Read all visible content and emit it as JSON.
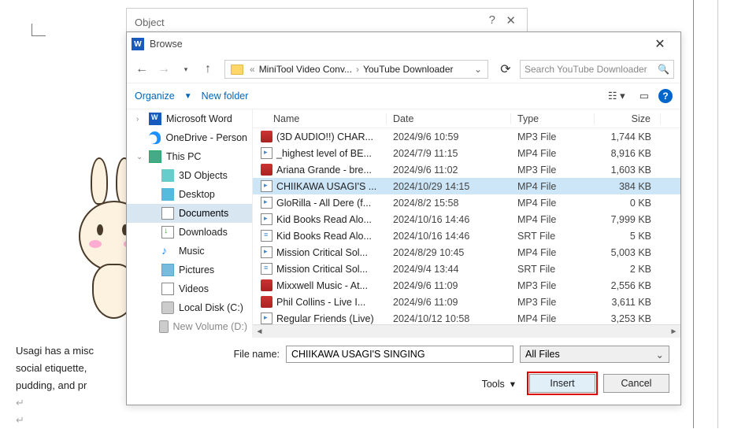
{
  "object_dialog": {
    "title": "Object"
  },
  "browse": {
    "title": "Browse",
    "breadcrumb": {
      "seg1": "MiniTool Video Conv...",
      "seg2": "YouTube Downloader"
    },
    "search_placeholder": "Search YouTube Downloader",
    "organize": "Organize",
    "new_folder": "New folder"
  },
  "tree": {
    "items": [
      {
        "label": "Microsoft Word",
        "icon": "word"
      },
      {
        "label": "OneDrive - Person",
        "icon": "cloud"
      },
      {
        "label": "This PC",
        "icon": "pc"
      },
      {
        "label": "3D Objects",
        "icon": "cube"
      },
      {
        "label": "Desktop",
        "icon": "desk"
      },
      {
        "label": "Documents",
        "icon": "doc"
      },
      {
        "label": "Downloads",
        "icon": "down"
      },
      {
        "label": "Music",
        "icon": "music"
      },
      {
        "label": "Pictures",
        "icon": "pic"
      },
      {
        "label": "Videos",
        "icon": "vid"
      },
      {
        "label": "Local Disk (C:)",
        "icon": "disk"
      },
      {
        "label": "New Volume (D:)",
        "icon": "disk"
      }
    ]
  },
  "columns": {
    "name": "Name",
    "date": "Date",
    "type": "Type",
    "size": "Size"
  },
  "rows": [
    {
      "name": "(3D AUDIO!!) CHAR...",
      "date": "2024/9/6 10:59",
      "type": "MP3 File",
      "size": "1,744 KB",
      "ico": "mp3"
    },
    {
      "name": "_highest level of BE...",
      "date": "2024/7/9 11:15",
      "type": "MP4 File",
      "size": "8,916 KB",
      "ico": "mp4"
    },
    {
      "name": "Ariana Grande - bre...",
      "date": "2024/9/6 11:02",
      "type": "MP3 File",
      "size": "1,603 KB",
      "ico": "mp3"
    },
    {
      "name": "CHIIKAWA USAGI'S ...",
      "date": "2024/10/29 14:15",
      "type": "MP4 File",
      "size": "384 KB",
      "ico": "mp4",
      "sel": true
    },
    {
      "name": "GloRilla - All Dere (f...",
      "date": "2024/8/2 15:58",
      "type": "MP4 File",
      "size": "0 KB",
      "ico": "mp4"
    },
    {
      "name": "Kid Books Read Alo...",
      "date": "2024/10/16 14:46",
      "type": "MP4 File",
      "size": "7,999 KB",
      "ico": "mp4"
    },
    {
      "name": "Kid Books Read Alo...",
      "date": "2024/10/16 14:46",
      "type": "SRT File",
      "size": "5 KB",
      "ico": "srt"
    },
    {
      "name": "Mission Critical Sol...",
      "date": "2024/8/29 10:45",
      "type": "MP4 File",
      "size": "5,003 KB",
      "ico": "mp4"
    },
    {
      "name": "Mission Critical Sol...",
      "date": "2024/9/4 13:44",
      "type": "SRT File",
      "size": "2 KB",
      "ico": "srt"
    },
    {
      "name": "Mixxwell Music - At...",
      "date": "2024/9/6 11:09",
      "type": "MP3 File",
      "size": "2,556 KB",
      "ico": "mp3"
    },
    {
      "name": "Phil Collins - Live  I...",
      "date": "2024/9/6 11:09",
      "type": "MP3 File",
      "size": "3,611 KB",
      "ico": "mp3"
    },
    {
      "name": "Regular Friends (Live)",
      "date": "2024/10/12 10:58",
      "type": "MP4 File",
      "size": "3,253 KB",
      "ico": "mp4"
    }
  ],
  "footer": {
    "file_name_label": "File name:",
    "file_name_value": "CHIIKAWA USAGI'S SINGING",
    "filter": "All Files",
    "tools": "Tools",
    "insert": "Insert",
    "cancel": "Cancel"
  },
  "doc": {
    "line1": "Usagi has a misc",
    "line2": "social etiquette,",
    "line3": "pudding, and pr"
  }
}
